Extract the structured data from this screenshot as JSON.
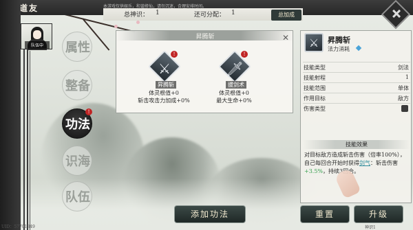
{
  "topbar": {
    "title": "道友",
    "scroll_text": "本游戏仅供娱乐，和谐修仙，请勿沉迷，合理安排时间。",
    "total_label": "总神识：",
    "total_value": "1",
    "alloc_label": "还可分配：",
    "alloc_value": "1",
    "boost_label": "总加成"
  },
  "avatar": {
    "label": "队伍中"
  },
  "tabs": [
    {
      "label": "属性",
      "active": false
    },
    {
      "label": "整备",
      "active": false
    },
    {
      "label": "功法",
      "active": true,
      "badge": "!"
    },
    {
      "label": "识海",
      "active": false
    },
    {
      "label": "队伍",
      "active": false
    }
  ],
  "skill_panel": {
    "title": "昇腾斩",
    "skills": [
      {
        "name": "昇腾斩",
        "line1": "体灵根值+0",
        "line2": "斩击攻击力加成+0%",
        "badge": "!"
      },
      {
        "name": "拔剑术",
        "line1": "体灵根值+0",
        "line2": "最大生命+0%",
        "badge": "!"
      }
    ]
  },
  "detail": {
    "name": "昇腾斩",
    "sub": "法力消耗",
    "rows": [
      {
        "k": "技能类型",
        "v": "剑法"
      },
      {
        "k": "技能射程",
        "v": "1"
      },
      {
        "k": "技能范围",
        "v": "单体"
      },
      {
        "k": "作用目标",
        "v": "敌方"
      },
      {
        "k": "伤害类型",
        "v": ""
      }
    ],
    "effect_head": "技能效果",
    "effect_1": "对目标敌方造成斩击伤害（倍率100%），自己每回合开始时获得",
    "effect_link": "剑气",
    "effect_2": "：斩击伤害",
    "effect_bonus": "+3.5%",
    "effect_3": "，持续3回合。"
  },
  "buttons": {
    "add": "添加功法",
    "reset": "重置",
    "upgrade": "升级"
  },
  "footer": {
    "left": "UID：57701849",
    "right": "神识1"
  }
}
